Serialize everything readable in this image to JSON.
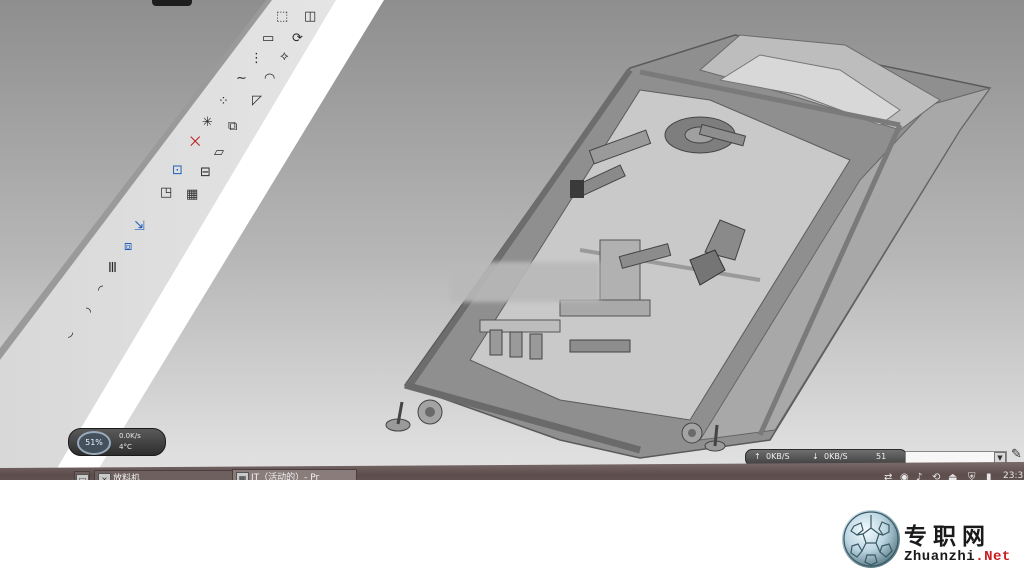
{
  "taskbar": {
    "items": [
      {
        "label": "放料机",
        "icon": "×",
        "icon_name": "cad-window-icon"
      },
      {
        "label": "JT（活动的）- Pr",
        "icon": "▦",
        "icon_name": "cad-document-icon"
      }
    ]
  },
  "gadget": {
    "percent": "51%",
    "line1": "0.0K/s",
    "line2": "4°C",
    "icon_name": "system-monitor-gadget"
  },
  "network": {
    "upload": "0KB/S",
    "download": "0KB/S",
    "value": "51"
  },
  "tray": {
    "time": "23:3"
  },
  "watermark": {
    "brand_cn": "专职网",
    "domain_name": "Zhuanzhi",
    "domain_tld": ".Net"
  },
  "colors": {
    "viewport_top": "#8e8e8e",
    "viewport_bottom": "#f0f0f0",
    "taskbar": "#5c4c4c",
    "model": "#8a8a8a",
    "watermark_accent": "#c81e1e"
  },
  "icons": [
    "rectangle-tool-icon",
    "spline-tool-icon",
    "point-tool-icon",
    "mirror-tool-icon",
    "dimension-tool-icon",
    "extrude-tool-icon",
    "revolve-tool-icon",
    "fillet-tool-icon",
    "chamfer-tool-icon",
    "pattern-tool-icon"
  ]
}
